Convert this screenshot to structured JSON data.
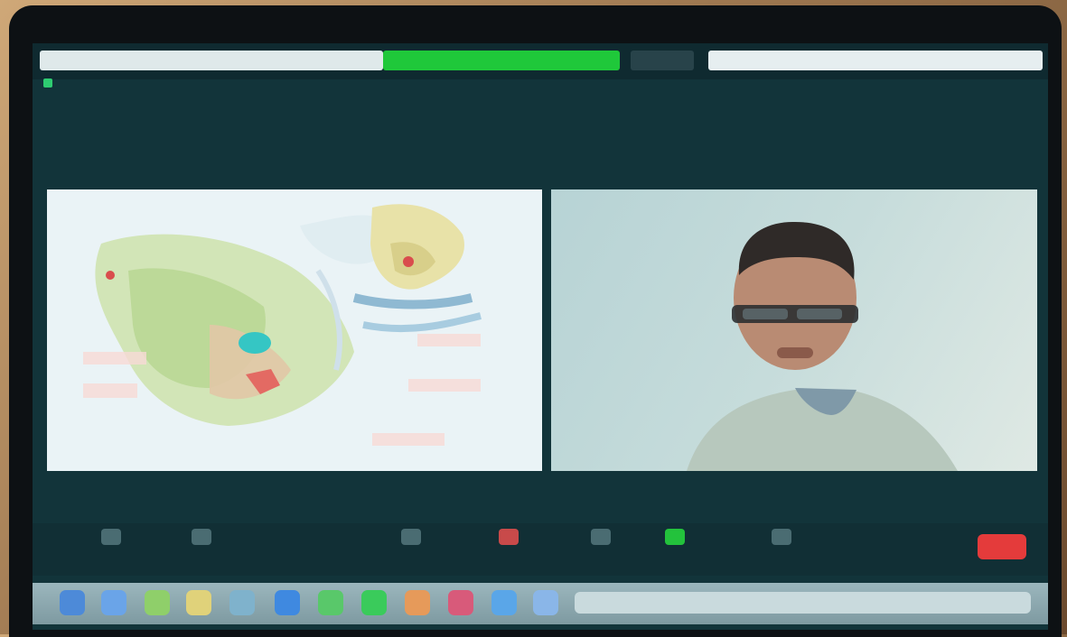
{
  "titlebar": {
    "left_text": "",
    "center_text": "",
    "right_text": "",
    "view_label": ""
  },
  "toolbar": {
    "items": [
      "",
      "",
      "",
      "",
      "",
      "",
      ""
    ],
    "end_label": ""
  },
  "colors": {
    "screen_bg": "#12343a",
    "meeting_green": "#1fc83a",
    "end_red": "#e43b3b"
  },
  "icons": {
    "security": "shield-icon",
    "mute": "microphone-icon",
    "video": "camera-icon",
    "participants": "people-icon",
    "chat": "chat-icon",
    "share": "share-screen-icon",
    "record": "record-icon",
    "reactions": "reactions-icon"
  }
}
